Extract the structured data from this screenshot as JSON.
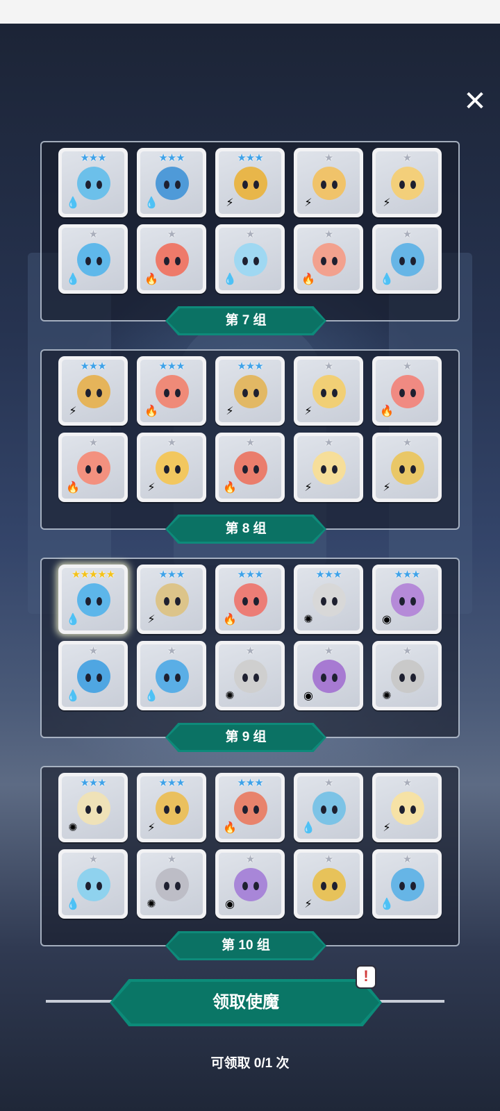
{
  "close_label": "✕",
  "groups": [
    {
      "label": "第 7 组",
      "cards": [
        {
          "stars": "★★★",
          "tier": "blue",
          "element": "water",
          "element_glyph": "💧",
          "color": "#6cc0ea"
        },
        {
          "stars": "★★★",
          "tier": "blue",
          "element": "water",
          "element_glyph": "💧",
          "color": "#4f9ad8"
        },
        {
          "stars": "★★★",
          "tier": "blue",
          "element": "lightning",
          "element_glyph": "⚡",
          "color": "#e8b64a"
        },
        {
          "stars": "★",
          "tier": "silver",
          "element": "lightning",
          "element_glyph": "⚡",
          "color": "#f0c36a"
        },
        {
          "stars": "★",
          "tier": "silver",
          "element": "lightning",
          "element_glyph": "⚡",
          "color": "#f3cf7a"
        },
        {
          "stars": "★",
          "tier": "silver",
          "element": "water",
          "element_glyph": "💧",
          "color": "#5fb8ea"
        },
        {
          "stars": "★",
          "tier": "silver",
          "element": "fire",
          "element_glyph": "🔥",
          "color": "#ee7a6a"
        },
        {
          "stars": "★",
          "tier": "silver",
          "element": "water",
          "element_glyph": "💧",
          "color": "#9fd8f2"
        },
        {
          "stars": "★",
          "tier": "silver",
          "element": "fire",
          "element_glyph": "🔥",
          "color": "#f2a18e"
        },
        {
          "stars": "★",
          "tier": "silver",
          "element": "water",
          "element_glyph": "💧",
          "color": "#66b5e6"
        }
      ]
    },
    {
      "label": "第 8 组",
      "cards": [
        {
          "stars": "★★★",
          "tier": "blue",
          "element": "lightning",
          "element_glyph": "⚡",
          "color": "#e5b45a"
        },
        {
          "stars": "★★★",
          "tier": "blue",
          "element": "fire",
          "element_glyph": "🔥",
          "color": "#ef8a78"
        },
        {
          "stars": "★★★",
          "tier": "blue",
          "element": "lightning",
          "element_glyph": "⚡",
          "color": "#e2b864"
        },
        {
          "stars": "★",
          "tier": "silver",
          "element": "lightning",
          "element_glyph": "⚡",
          "color": "#f1cf75"
        },
        {
          "stars": "★",
          "tier": "silver",
          "element": "fire",
          "element_glyph": "🔥",
          "color": "#f08a82"
        },
        {
          "stars": "★",
          "tier": "silver",
          "element": "fire",
          "element_glyph": "🔥",
          "color": "#f3917f"
        },
        {
          "stars": "★",
          "tier": "silver",
          "element": "lightning",
          "element_glyph": "⚡",
          "color": "#f2c75f"
        },
        {
          "stars": "★",
          "tier": "silver",
          "element": "fire",
          "element_glyph": "🔥",
          "color": "#ea7d6c"
        },
        {
          "stars": "★",
          "tier": "silver",
          "element": "lightning",
          "element_glyph": "⚡",
          "color": "#f6de9a"
        },
        {
          "stars": "★",
          "tier": "silver",
          "element": "lightning",
          "element_glyph": "⚡",
          "color": "#e9c767"
        }
      ]
    },
    {
      "label": "第 9 组",
      "cards": [
        {
          "stars": "★★★★★",
          "tier": "gold",
          "element": "water",
          "element_glyph": "💧",
          "color": "#5db6ea",
          "highlight": true
        },
        {
          "stars": "★★★",
          "tier": "blue",
          "element": "lightning",
          "element_glyph": "⚡",
          "color": "#dcc48a"
        },
        {
          "stars": "★★★",
          "tier": "blue",
          "element": "fire",
          "element_glyph": "🔥",
          "color": "#ec7d76"
        },
        {
          "stars": "★★★",
          "tier": "blue",
          "element": "light",
          "element_glyph": "✺",
          "color": "#d8d8d8"
        },
        {
          "stars": "★★★",
          "tier": "blue",
          "element": "dark",
          "element_glyph": "◉",
          "color": "#b58ad8"
        },
        {
          "stars": "★",
          "tier": "silver",
          "element": "water",
          "element_glyph": "💧",
          "color": "#4fa6e2"
        },
        {
          "stars": "★",
          "tier": "silver",
          "element": "water",
          "element_glyph": "💧",
          "color": "#5aaee6"
        },
        {
          "stars": "★",
          "tier": "silver",
          "element": "light",
          "element_glyph": "✺",
          "color": "#cfcfcf"
        },
        {
          "stars": "★",
          "tier": "silver",
          "element": "dark",
          "element_glyph": "◉",
          "color": "#a77ad2"
        },
        {
          "stars": "★",
          "tier": "silver",
          "element": "light",
          "element_glyph": "✺",
          "color": "#c9c9c9"
        }
      ]
    },
    {
      "label": "第 10 组",
      "cards": [
        {
          "stars": "★★★",
          "tier": "blue",
          "element": "light",
          "element_glyph": "✺",
          "color": "#efe2b8"
        },
        {
          "stars": "★★★",
          "tier": "blue",
          "element": "lightning",
          "element_glyph": "⚡",
          "color": "#eac05e"
        },
        {
          "stars": "★★★",
          "tier": "blue",
          "element": "fire",
          "element_glyph": "🔥",
          "color": "#e8836c"
        },
        {
          "stars": "★",
          "tier": "silver",
          "element": "water",
          "element_glyph": "💧",
          "color": "#7cc3e6"
        },
        {
          "stars": "★",
          "tier": "silver",
          "element": "lightning",
          "element_glyph": "⚡",
          "color": "#f6e2a6"
        },
        {
          "stars": "★",
          "tier": "silver",
          "element": "water",
          "element_glyph": "💧",
          "color": "#8fd2ee"
        },
        {
          "stars": "★",
          "tier": "silver",
          "element": "light",
          "element_glyph": "✺",
          "color": "#bdbdc6"
        },
        {
          "stars": "★",
          "tier": "silver",
          "element": "dark",
          "element_glyph": "◉",
          "color": "#a886d8"
        },
        {
          "stars": "★",
          "tier": "silver",
          "element": "lightning",
          "element_glyph": "⚡",
          "color": "#e7c25a"
        },
        {
          "stars": "★",
          "tier": "silver",
          "element": "water",
          "element_glyph": "💧",
          "color": "#66b5e6"
        }
      ]
    }
  ],
  "claim_button_label": "领取使魔",
  "alert_badge": "!",
  "claim_count": "可领取 0/1 次"
}
